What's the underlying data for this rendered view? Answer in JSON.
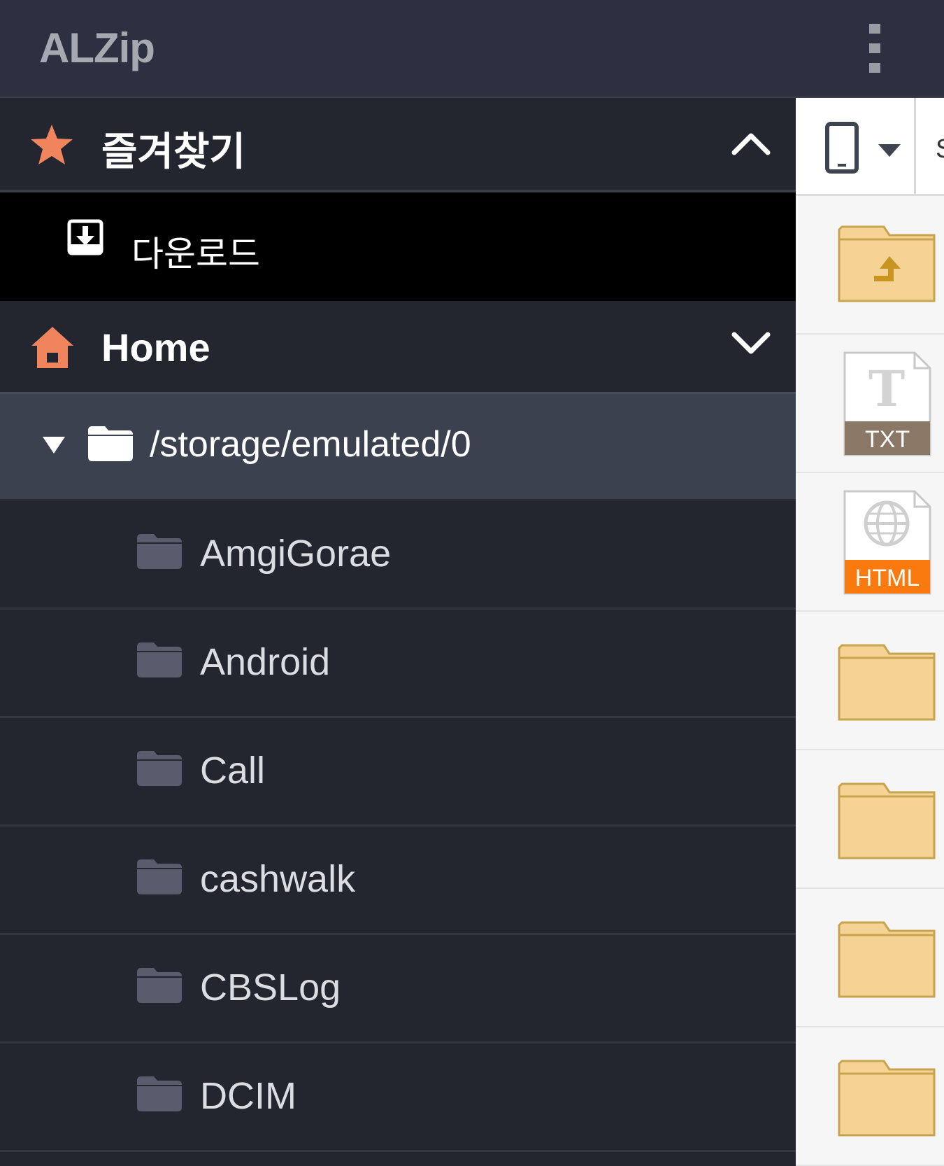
{
  "app": {
    "title": "ALZip"
  },
  "drawer": {
    "favorites": {
      "label": "즐겨찾기",
      "icon": "star-icon",
      "items": [
        {
          "label": "다운로드",
          "icon": "download-icon"
        }
      ]
    },
    "home": {
      "label": "Home",
      "icon": "home-icon",
      "root_path": "/storage/emulated/0",
      "folders": [
        "AmgiGorae",
        "Android",
        "Call",
        "cashwalk",
        "CBSLog",
        "DCIM"
      ]
    }
  },
  "panel": {
    "storage_icon": "phone-icon",
    "files": [
      {
        "type": "folder-up",
        "icon": "folder-up-icon"
      },
      {
        "type": "txt",
        "icon": "txt-file-icon",
        "badge": "TXT"
      },
      {
        "type": "html",
        "icon": "html-file-icon",
        "badge": "HTML"
      },
      {
        "type": "folder",
        "icon": "folder-icon"
      },
      {
        "type": "folder",
        "icon": "folder-icon"
      },
      {
        "type": "folder",
        "icon": "folder-icon"
      },
      {
        "type": "folder",
        "icon": "folder-icon"
      }
    ]
  },
  "colors": {
    "accent": "#f0845c",
    "drawer_bg": "#23262f",
    "appbar_bg": "#2d3040",
    "selected_row": "#3c4150",
    "folder_yellow": "#f5d394",
    "html_badge": "#fa7a10",
    "txt_badge": "#8b7766"
  }
}
